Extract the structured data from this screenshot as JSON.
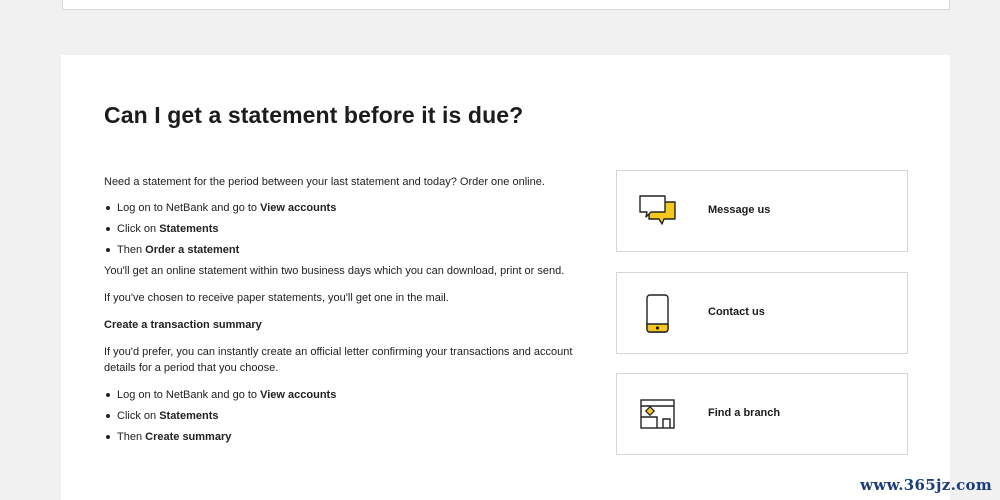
{
  "heading": "Can I get a statement before it is due?",
  "intro": "Need a statement for the period between your last statement and today? Order one online.",
  "order_steps": [
    {
      "prefix": "Log on to NetBank and go to ",
      "emphasis": "View accounts"
    },
    {
      "prefix": "Click on ",
      "emphasis": "Statements"
    },
    {
      "prefix": "Then ",
      "emphasis": "Order a statement"
    }
  ],
  "online_note": "You'll get an online statement within two business days which you can download, print or send.",
  "paper_note": "If you've chosen to receive paper statements, you'll get one in the mail.",
  "summary_heading": "Create a transaction summary",
  "summary_text": "If you'd prefer, you can instantly create an official letter confirming your transactions and account details for a period that you choose.",
  "summary_steps": [
    {
      "prefix": "Log on to NetBank and go to ",
      "emphasis": "View accounts"
    },
    {
      "prefix": "Click on ",
      "emphasis": "Statements"
    },
    {
      "prefix": "Then ",
      "emphasis": "Create summary"
    }
  ],
  "side_cards": {
    "message": {
      "label": "Message us",
      "icon": "chat-bubbles-icon"
    },
    "contact": {
      "label": "Contact us",
      "icon": "mobile-phone-icon"
    },
    "branch": {
      "label": "Find a branch",
      "icon": "branch-map-icon"
    }
  },
  "colors": {
    "accent": "#f4c81e",
    "text": "#222222",
    "card_border": "#d6d6d6",
    "watermark": "#1c3d7a"
  },
  "watermark": "www.365jz.com"
}
